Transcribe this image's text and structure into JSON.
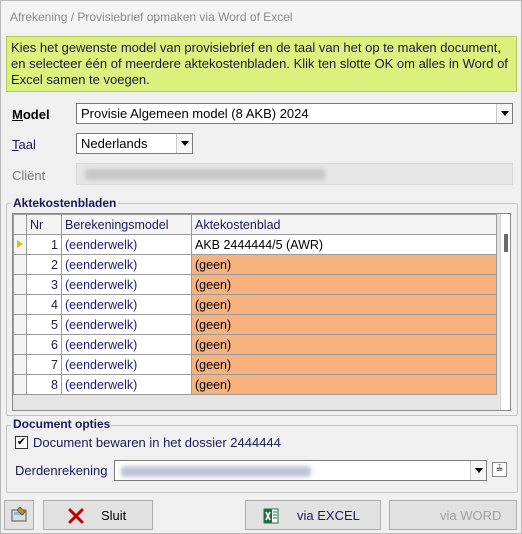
{
  "window": {
    "title": "Afrekening / Provisiebrief opmaken via Word of Excel"
  },
  "info": {
    "text": "Kies het gewenste model van provisiebrief en de taal van het op te maken document, en selecteer één of meerdere aktekostenbladen. Klik ten slotte OK om alles in Word of Excel samen te voegen."
  },
  "model": {
    "label": "Model",
    "value": "Provisie Algemeen model (8 AKB) 2024"
  },
  "taal": {
    "label": "Taal",
    "value": "Nederlands"
  },
  "client": {
    "label": "Cliënt"
  },
  "aktekostenbladen": {
    "title": "Aktekostenbladen",
    "columns": [
      "Nr",
      "Berekeningsmodel",
      "Aktekostenblad"
    ],
    "rows": [
      {
        "nr": "1",
        "model": "(eenderwelk)",
        "blad": "AKB 2444444/5 (AWR)"
      },
      {
        "nr": "2",
        "model": "(eenderwelk)",
        "blad": "(geen)"
      },
      {
        "nr": "3",
        "model": "(eenderwelk)",
        "blad": "(geen)"
      },
      {
        "nr": "4",
        "model": "(eenderwelk)",
        "blad": "(geen)"
      },
      {
        "nr": "5",
        "model": "(eenderwelk)",
        "blad": "(geen)"
      },
      {
        "nr": "6",
        "model": "(eenderwelk)",
        "blad": "(geen)"
      },
      {
        "nr": "7",
        "model": "(eenderwelk)",
        "blad": "(geen)"
      },
      {
        "nr": "8",
        "model": "(eenderwelk)",
        "blad": "(geen)"
      }
    ]
  },
  "document_opties": {
    "title": "Document opties",
    "bewaren_label": "Document bewaren in het dossier 2444444",
    "bewaren_checked": true,
    "derdenrekening_label": "Derdenrekening"
  },
  "buttons": {
    "sluit": "Sluit",
    "excel": "via EXCEL",
    "word": "via WORD"
  },
  "colors": {
    "info_bg": "#dcf07e",
    "empty_row": "#f7b27e"
  }
}
